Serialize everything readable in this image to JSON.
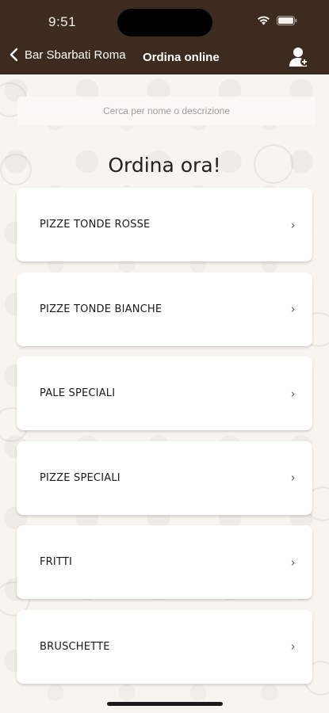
{
  "status": {
    "time": "9:51"
  },
  "nav": {
    "back_label": "Bar Sbarbati Roma",
    "title": "Ordina online"
  },
  "search": {
    "placeholder": "Cerca per nome o descrizione"
  },
  "page_title": "Ordina ora!",
  "categories": [
    {
      "label": "PIZZE TONDE ROSSE"
    },
    {
      "label": "PIZZE TONDE BIANCHE"
    },
    {
      "label": "PALE SPECIALI"
    },
    {
      "label": "PIZZE SPECIALI"
    },
    {
      "label": "FRITTI"
    },
    {
      "label": "BRUSCHETTE"
    }
  ],
  "colors": {
    "header": "#3e2b1f",
    "background": "#f8f4ef",
    "card": "#ffffff"
  },
  "icons": {
    "back": "chevron-left-icon",
    "profile": "user-icon",
    "row": "chevron-right-icon"
  }
}
